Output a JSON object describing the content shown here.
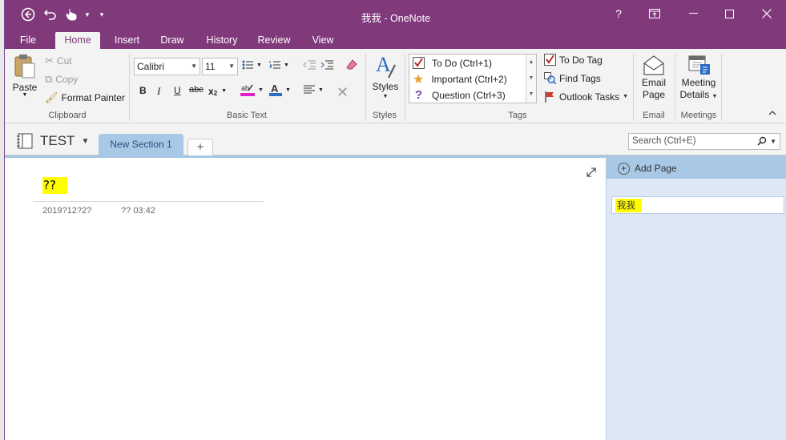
{
  "window": {
    "title": "我我 - OneNote",
    "help_label": "?",
    "colors": {
      "titlebar": "#80397b",
      "ribbon": "#f3f3f3",
      "section_tab": "#a9c8e6",
      "highlight": "#ffff00"
    }
  },
  "ribbon_tabs": [
    "File",
    "Home",
    "Insert",
    "Draw",
    "History",
    "Review",
    "View"
  ],
  "ribbon_active_tab": "Home",
  "clipboard": {
    "paste": "Paste",
    "cut": "Cut",
    "copy": "Copy",
    "format_painter": "Format Painter",
    "group": "Clipboard"
  },
  "basic_text": {
    "font": "Calibri",
    "size": "11",
    "bold": "B",
    "italic": "I",
    "underline": "U",
    "strike": "abc",
    "subscript": "x",
    "subscript_2": "2",
    "group": "Basic Text"
  },
  "styles": {
    "label": "Styles",
    "group": "Styles"
  },
  "tags": {
    "items": [
      "To Do (Ctrl+1)",
      "Important (Ctrl+2)",
      "Question (Ctrl+3)"
    ],
    "todo_tag": "To Do Tag",
    "find_tags": "Find Tags",
    "outlook_tasks": "Outlook Tasks",
    "group": "Tags"
  },
  "email": {
    "line1": "Email",
    "line2": "Page",
    "group": "Email"
  },
  "meetings": {
    "line1": "Meeting",
    "line2": "Details",
    "group": "Meetings"
  },
  "notebook": {
    "name": "TEST",
    "section": "New Section 1",
    "add_section": "+",
    "search_placeholder": "Search (Ctrl+E)"
  },
  "page": {
    "title": "??",
    "date": "2019?12?2?",
    "time_prefix": "??",
    "time": "03:42"
  },
  "page_list": {
    "add_page": "Add Page",
    "pages": [
      "我我"
    ]
  }
}
